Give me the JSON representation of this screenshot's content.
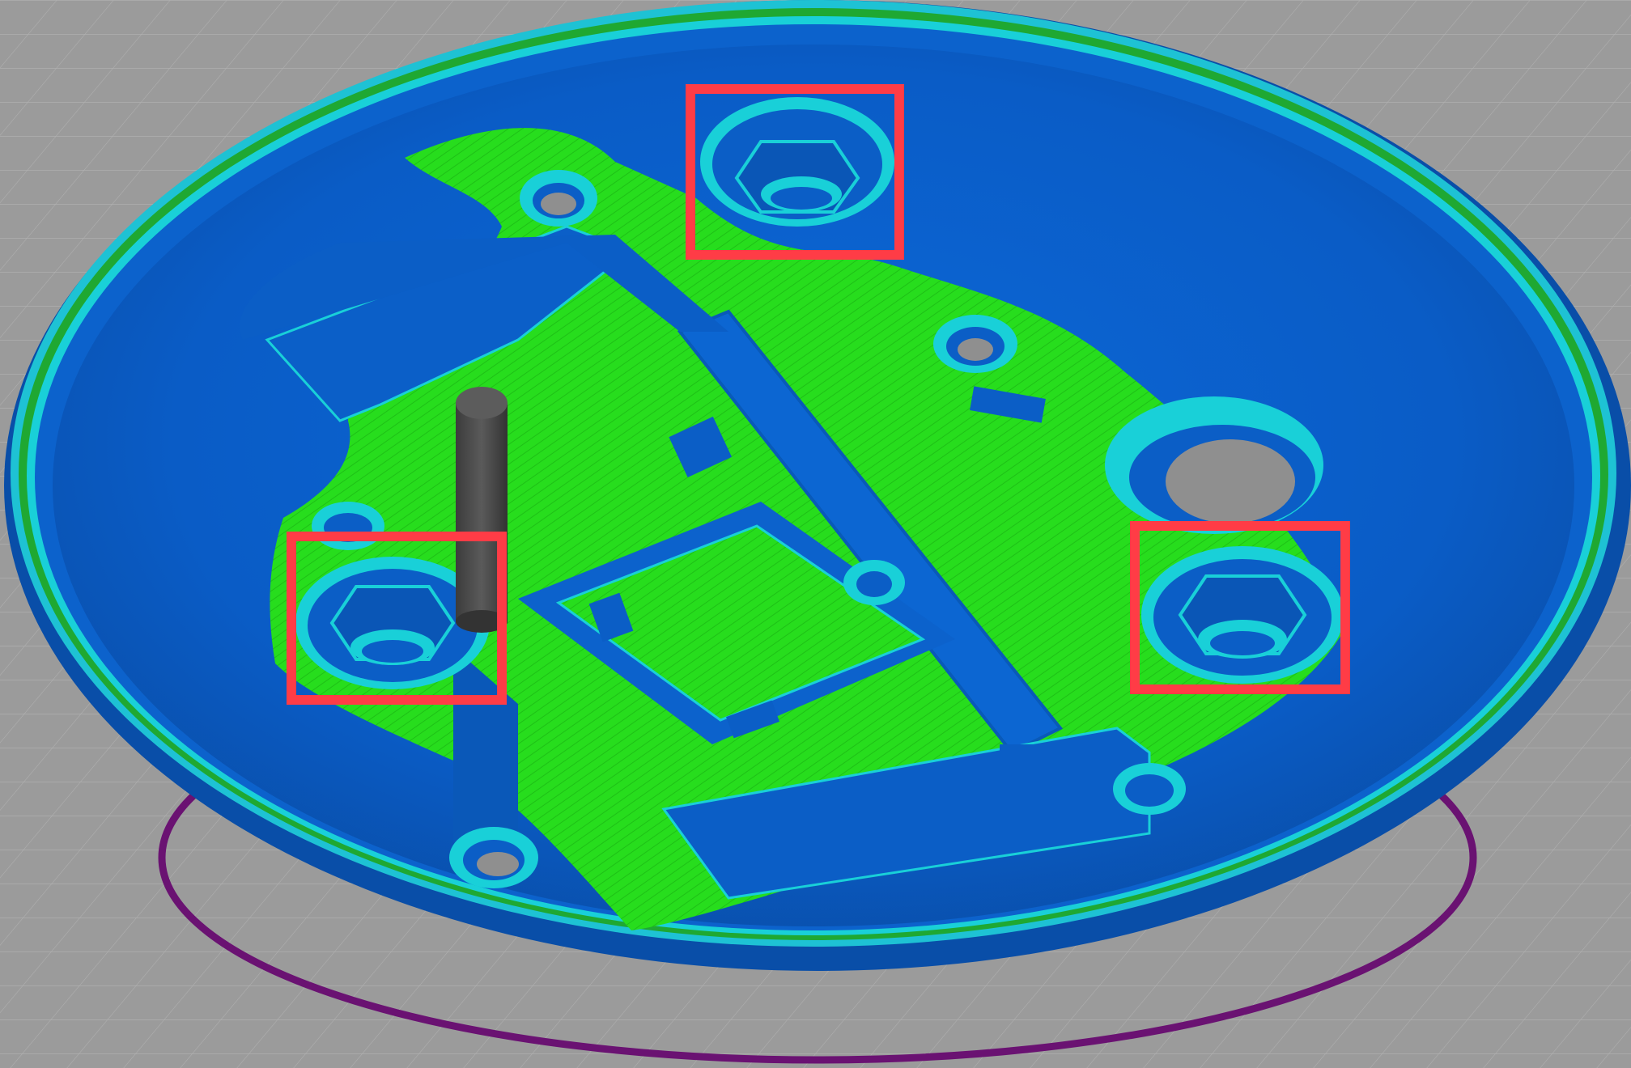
{
  "app": {
    "view": "slicer-preview-3d"
  },
  "colors": {
    "background": "#9b9b9b",
    "grid_line": "#b4b4b4",
    "wall_outer": "#0b62d0",
    "wall_inner": "#0a5cc4",
    "shell_dark": "#094fa8",
    "perimeter_highlight": "#19d0d8",
    "infill": "#25dc1c",
    "infill_line": "#1fb81a",
    "skirt": "#6a1272",
    "hole_shadow": "#8f8f8f",
    "highlight_box": "#ff3c46",
    "pin": "#505050"
  },
  "model": {
    "description_visible": false
  },
  "annotations": {
    "highlight_boxes": [
      {
        "name": "highlight-box-top-nut-trap"
      },
      {
        "name": "highlight-box-left-nut-trap"
      },
      {
        "name": "highlight-box-right-nut-trap"
      }
    ]
  },
  "icons": {
    "nut_trap": "hexagon-nut-trap-icon",
    "screw_hole": "circle-hole-icon"
  }
}
